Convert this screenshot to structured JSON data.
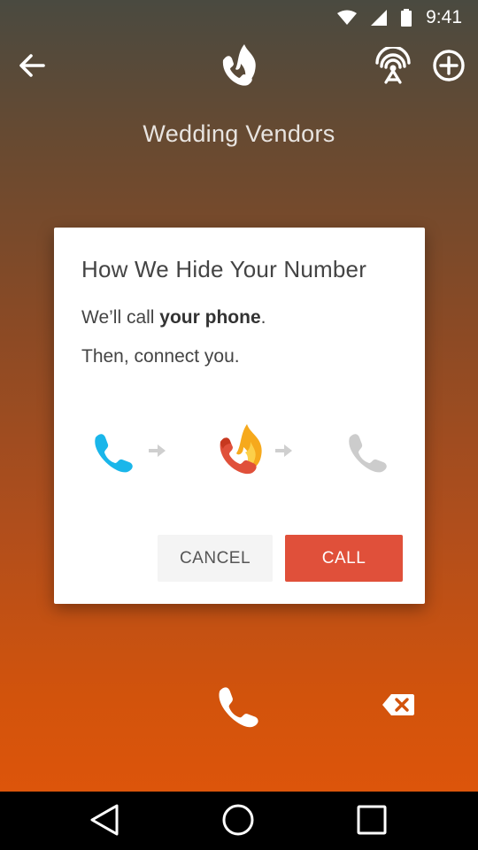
{
  "status_bar": {
    "time": "9:41",
    "icons": [
      "wifi-icon",
      "cell-signal-icon",
      "battery-icon"
    ]
  },
  "toolbar": {
    "back_icon": "arrow-left-icon",
    "logo_icon": "burner-phone-flame-icon",
    "broadcast_icon": "broadcast-antenna-icon",
    "add_icon": "plus-circle-icon"
  },
  "page": {
    "title": "Wedding Vendors"
  },
  "dialog": {
    "title": "How We Hide Your Number",
    "line1_prefix": "We’ll call ",
    "line1_bold": "your phone",
    "line1_suffix": ".",
    "line2": "Then, connect you.",
    "flow_icons": [
      "phone-icon",
      "arrow-right-icon",
      "burner-flame-phone-icon",
      "arrow-right-icon",
      "phone-icon"
    ],
    "cancel_label": "CANCEL",
    "call_label": "CALL"
  },
  "dialer": {
    "call_icon": "phone-icon",
    "delete_icon": "backspace-icon"
  },
  "colors": {
    "accent_call": "#e0503a",
    "blue_phone": "#1ab6ea",
    "gradient_top": "#4a4a40",
    "gradient_bottom": "#e3560a"
  }
}
